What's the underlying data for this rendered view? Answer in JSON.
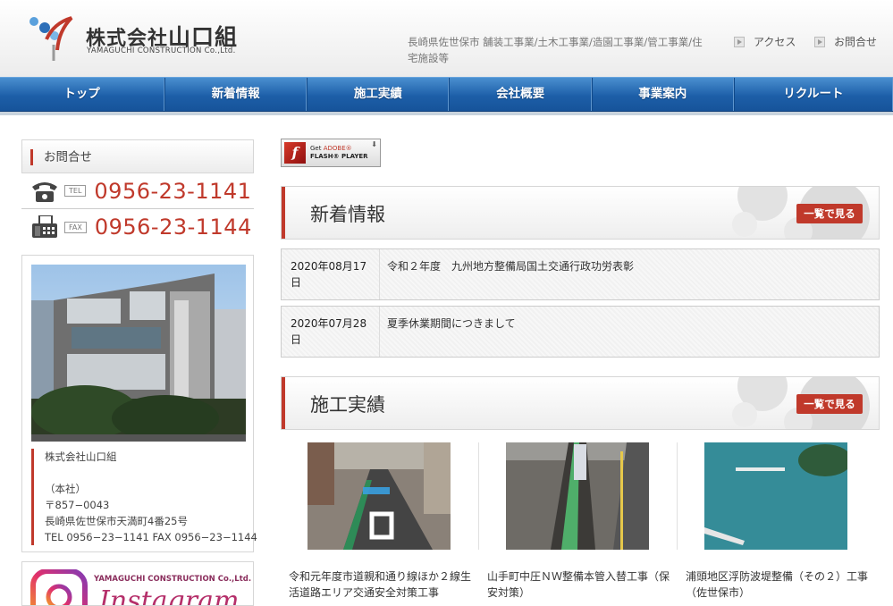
{
  "header": {
    "company_name": "株式会社",
    "company_name_big": "山口組",
    "company_name_en": "YAMAGUCHI CONSTRUCTION Co.,Ltd.",
    "tagline": "長崎県佐世保市 舗装工事業/土木工事業/造園工事業/管工事業/住宅施設等",
    "links": [
      {
        "label": "アクセス",
        "icon": "arrow-icon"
      },
      {
        "label": "お問合せ",
        "icon": "arrow-icon"
      }
    ]
  },
  "nav": {
    "items": [
      {
        "label": "トップ"
      },
      {
        "label": "新着情報"
      },
      {
        "label": "施工実績"
      },
      {
        "label": "会社概要"
      },
      {
        "label": "事業案内"
      },
      {
        "label": "リクルート"
      }
    ]
  },
  "sidebar": {
    "contact_title": "お問合せ",
    "tel_tag": "TEL",
    "tel": "0956-23-1141",
    "fax_tag": "FAX",
    "fax": "0956-23-1144",
    "company": "株式会社山口組",
    "office": "（本社）",
    "postal": "〒857−0043",
    "address": "長崎県佐世保市天満町4番25号",
    "telfax": "TEL 0956−23−1141 FAX 0956−23−1144",
    "banner_en": "YAMAGUCHI CONSTRUCTION Co.,Ltd.",
    "banner_label": "Instagram"
  },
  "flash": {
    "get": "Get",
    "adobe": "ADOBE®",
    "player": "FLASH® PLAYER",
    "f": "f"
  },
  "news_section": {
    "title": "新着情報",
    "more": "一覧で見る",
    "items": [
      {
        "date": "2020年08月17日",
        "title": "令和２年度　九州地方整備局国土交通行政功労表彰"
      },
      {
        "date": "2020年07月28日",
        "title": "夏季休業期間につきまして"
      }
    ]
  },
  "works_section": {
    "title": "施工実績",
    "more": "一覧で見る",
    "items": [
      {
        "caption": "令和元年度市道親和通り線ほか２線生活道路エリア交通安全対策工事"
      },
      {
        "caption": "山手町中圧ＮＷ整備本管入替工事（保安対策）"
      },
      {
        "caption": "浦頭地区浮防波堤整備（その２）工事（佐世保市）"
      }
    ]
  },
  "colors": {
    "accent": "#c0392b",
    "nav": "#1d5fa8"
  }
}
